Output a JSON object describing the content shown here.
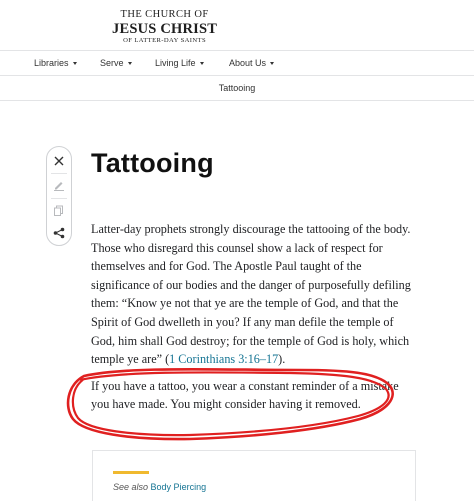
{
  "header": {
    "logo_line1": "THE CHURCH OF",
    "logo_line2": "JESUS CHRIST",
    "logo_line3": "OF LATTER-DAY SAINTS"
  },
  "nav": {
    "items": [
      {
        "label": "Libraries"
      },
      {
        "label": "Serve"
      },
      {
        "label": "Living Life"
      },
      {
        "label": "About Us"
      }
    ]
  },
  "breadcrumb": {
    "current": "Tattooing"
  },
  "toolbar": {
    "icons": [
      "close-icon",
      "pencil-icon",
      "copy-icon",
      "share-icon"
    ]
  },
  "article": {
    "title": "Tattooing",
    "paragraph1": "Latter-day prophets strongly discourage the tattooing of the body. Those who disregard this counsel show a lack of respect for themselves and for God. The Apostle Paul taught of the significance of our bodies and the danger of purposefully defiling them: “Know ye not that ye are the temple of God, and that the Spirit of God dwelleth in you? If any man defile the temple of God, him shall God destroy; for the temple of God is holy, which temple ye are” (",
    "scripture_ref": "1 Corinthians 3:16–17",
    "paragraph1_end": ").",
    "paragraph2": "If you have a tattoo, you wear a constant reminder of a mistake you have made. You might consider having it removed."
  },
  "see_also": {
    "label": "See also",
    "link": "Body Piercing"
  },
  "colors": {
    "link": "#157493",
    "accent_bar": "#f0b92f",
    "annotation": "#e02020"
  }
}
